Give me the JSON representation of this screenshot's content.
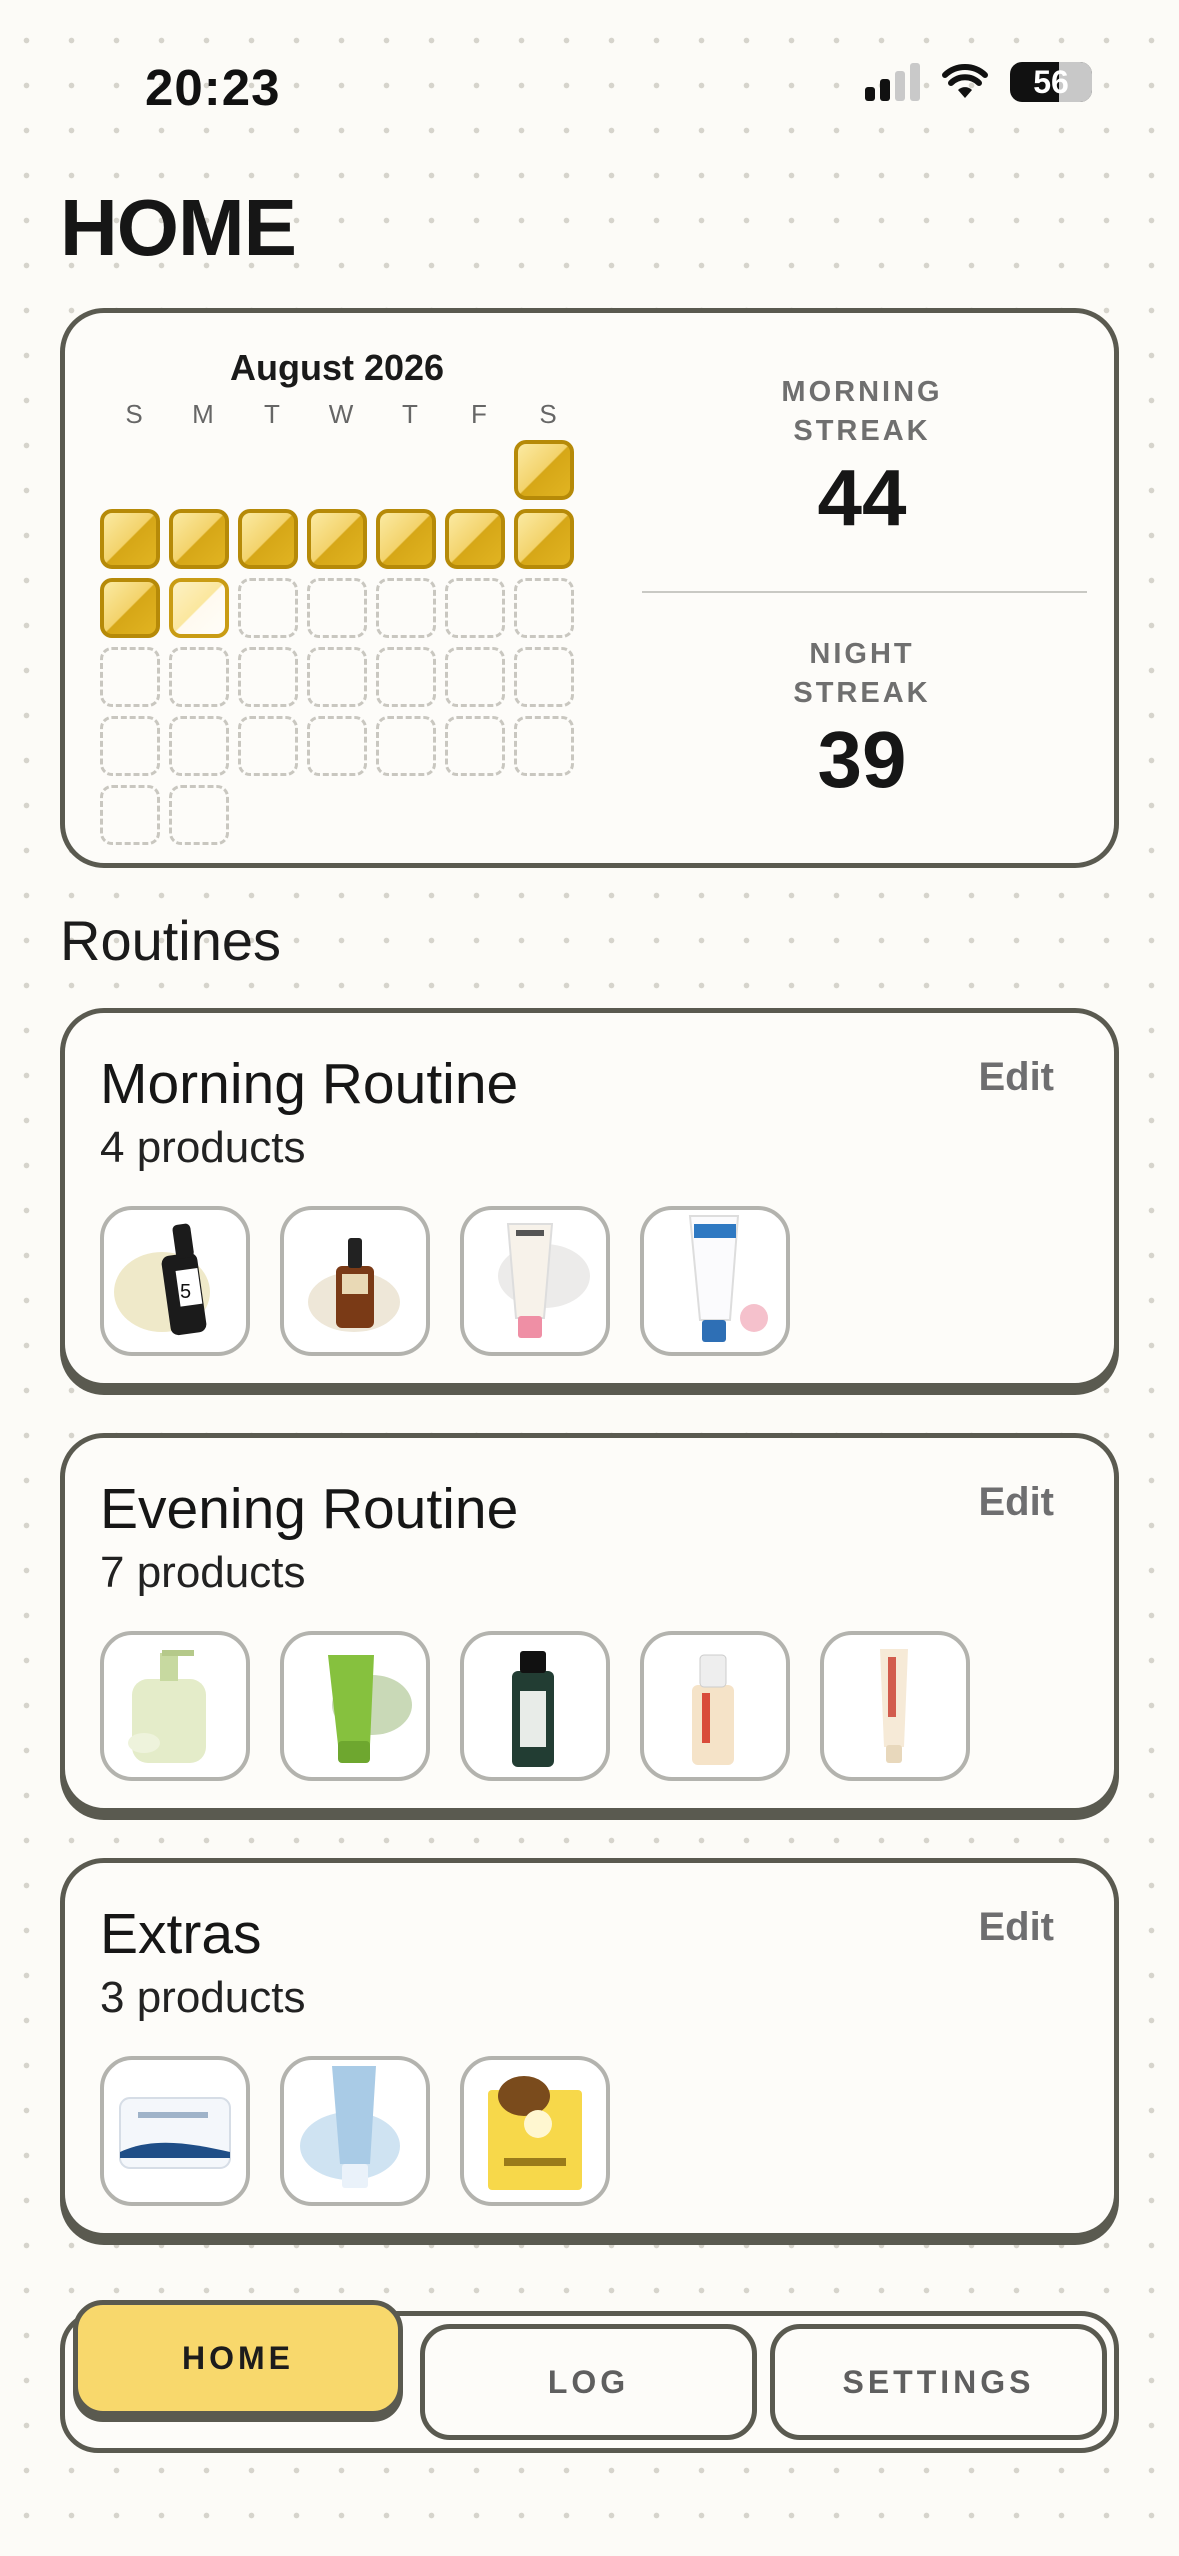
{
  "status_bar": {
    "time": "20:23",
    "battery": "56"
  },
  "page": {
    "title": "HOME"
  },
  "calendar": {
    "month": "August 2026",
    "weekdays": [
      "S",
      "M",
      "T",
      "W",
      "T",
      "F",
      "S"
    ],
    "first_weekday_index": 6,
    "days_in_month": 31,
    "completed_days": 9,
    "partial_days": [
      10
    ]
  },
  "streaks": {
    "morning": {
      "label": "MORNING STREAK",
      "value": "44"
    },
    "night": {
      "label": "NIGHT STREAK",
      "value": "39"
    }
  },
  "routines_section": {
    "title": "Routines"
  },
  "routines": [
    {
      "title": "Morning Routine",
      "count": "4 products",
      "edit": "Edit",
      "products": [
        "dropper-serum",
        "amber-ampoule",
        "pink-tube-cream",
        "blue-tube-cream"
      ]
    },
    {
      "title": "Evening Routine",
      "count": "7 products",
      "edit": "Edit",
      "products": [
        "cleansing-oil",
        "green-gel-cleanser",
        "dark-toner",
        "pump-serum",
        "slim-tube-cream"
      ]
    },
    {
      "title": "Extras",
      "count": "3 products",
      "edit": "Edit",
      "products": [
        "cream-jar",
        "blue-sunscreen-tube",
        "sheet-mask"
      ]
    }
  ],
  "tabs": [
    {
      "label": "HOME",
      "active": true
    },
    {
      "label": "LOG",
      "active": false
    },
    {
      "label": "SETTINGS",
      "active": false
    }
  ],
  "colors": {
    "accent": "#f8d86c",
    "gold": "#d6a717",
    "border": "#5a5a50"
  }
}
